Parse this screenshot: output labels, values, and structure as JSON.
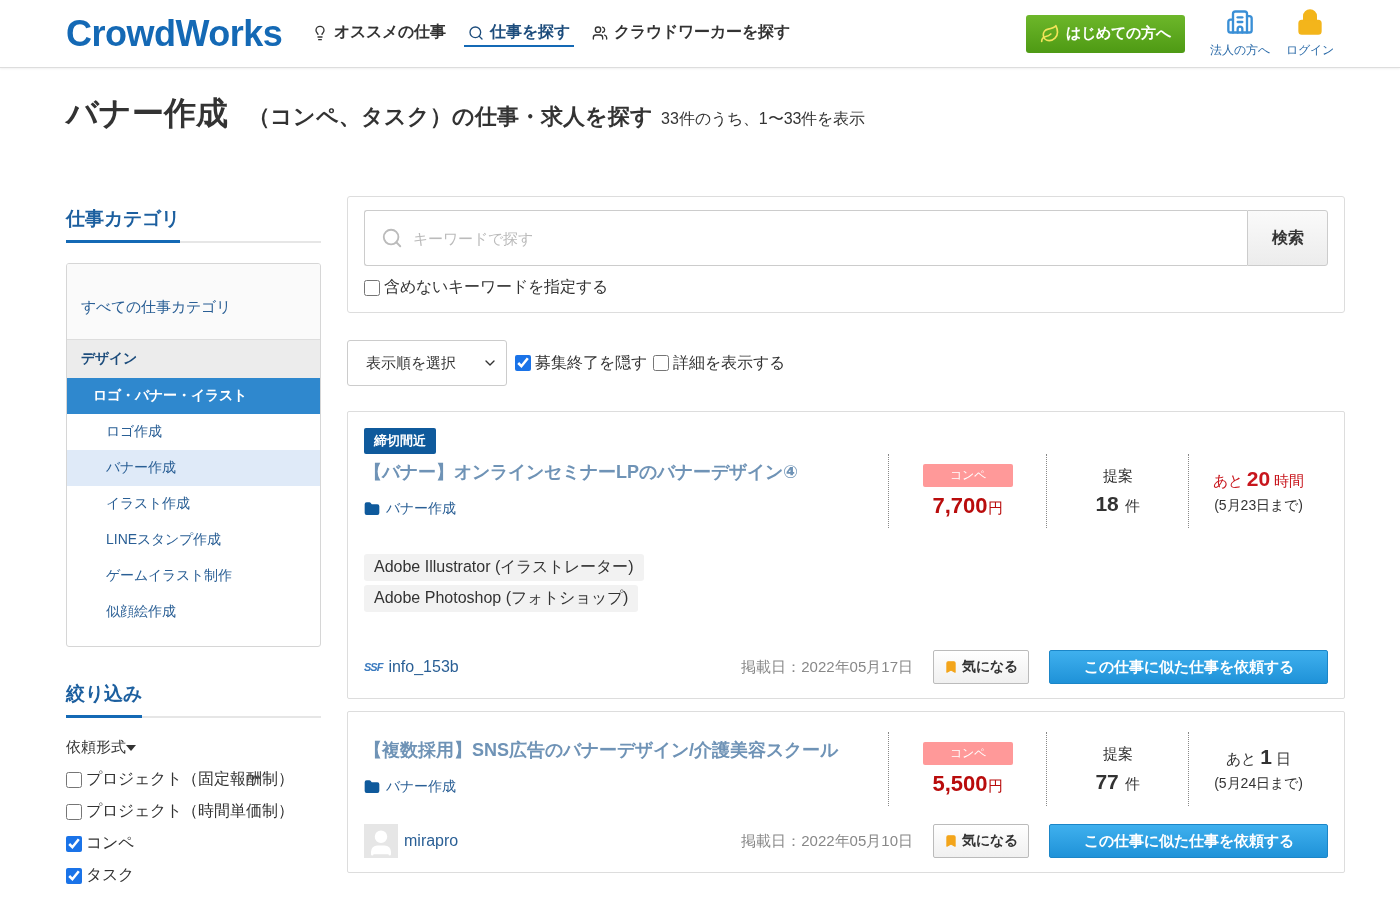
{
  "header": {
    "logo": "CrowdWorks",
    "nav": [
      {
        "label": "オススメの仕事",
        "selected": false
      },
      {
        "label": "仕事を探す",
        "selected": true
      },
      {
        "label": "クラウドワーカーを探す",
        "selected": false
      }
    ],
    "start_button": "はじめての方へ",
    "links": [
      {
        "label": "法人の方へ"
      },
      {
        "label": "ログイン"
      }
    ]
  },
  "page_title": {
    "main": "バナー作成",
    "sub": "（コンペ、タスク）の仕事・求人を探す",
    "count": "33件のうち、1〜33件を表示"
  },
  "sidebar": {
    "category_heading": "仕事カテゴリ",
    "all_label": "すべての仕事カテゴリ",
    "categories": [
      {
        "label": "デザイン",
        "children": [
          {
            "label": "ロゴ・バナー・イラスト",
            "selected": true,
            "children": [
              {
                "label": "ロゴ作成",
                "selected": false
              },
              {
                "label": "バナー作成",
                "selected": true
              },
              {
                "label": "イラスト作成",
                "selected": false
              },
              {
                "label": "LINEスタンプ作成",
                "selected": false
              },
              {
                "label": "ゲームイラスト制作",
                "selected": false
              },
              {
                "label": "似顔絵作成",
                "selected": false
              }
            ]
          }
        ]
      }
    ],
    "filter_heading": "絞り込み",
    "filter_group": "依頼形式",
    "filters": [
      {
        "label": "プロジェクト（固定報酬制）",
        "checked": false
      },
      {
        "label": "プロジェクト（時間単価制）",
        "checked": false
      },
      {
        "label": "コンペ",
        "checked": true
      },
      {
        "label": "タスク",
        "checked": true
      }
    ]
  },
  "search": {
    "placeholder": "キーワードで探す",
    "button": "検索",
    "exclude_label": "含めないキーワードを指定する",
    "exclude_checked": false
  },
  "options": {
    "sort_placeholder": "表示順を選択",
    "hide_closed_label": "募集終了を隠す",
    "hide_closed": true,
    "details_label": "詳細を表示する",
    "details": false
  },
  "jobs": [
    {
      "badge": "締切間近",
      "title": "【バナー】オンラインセミナーLPのバナーデザイン④",
      "category": "バナー作成",
      "type": "コンペ",
      "price": "7,700",
      "currency": "円",
      "proposals_label": "提案",
      "proposals": "18",
      "proposals_unit": "件",
      "remain_prefix": "あと",
      "remain": "20",
      "remain_unit": "時間",
      "urgent": true,
      "deadline": "(5月23日まで)",
      "skills": [
        "Adobe Illustrator (イラストレーター)",
        "Adobe Photoshop (フォトショップ)"
      ],
      "client": {
        "name": "info_153b",
        "kind": "logo",
        "logo_text": "SSF"
      },
      "posted": "掲載日：2022年05月17日",
      "bookmark": "気になる",
      "cta": "この仕事に似た仕事を依頼する"
    },
    {
      "title": "【複数採用】SNS広告のバナーデザイン/介護美容スクール",
      "category": "バナー作成",
      "type": "コンペ",
      "price": "5,500",
      "currency": "円",
      "proposals_label": "提案",
      "proposals": "77",
      "proposals_unit": "件",
      "remain_prefix": "あと",
      "remain": "1",
      "remain_unit": "日",
      "urgent": false,
      "deadline": "(5月24日まで)",
      "client": {
        "name": "mirapro",
        "kind": "avatar"
      },
      "posted": "掲載日：2022年05月10日",
      "bookmark": "気になる",
      "cta": "この仕事に似た仕事を依頼する"
    }
  ]
}
